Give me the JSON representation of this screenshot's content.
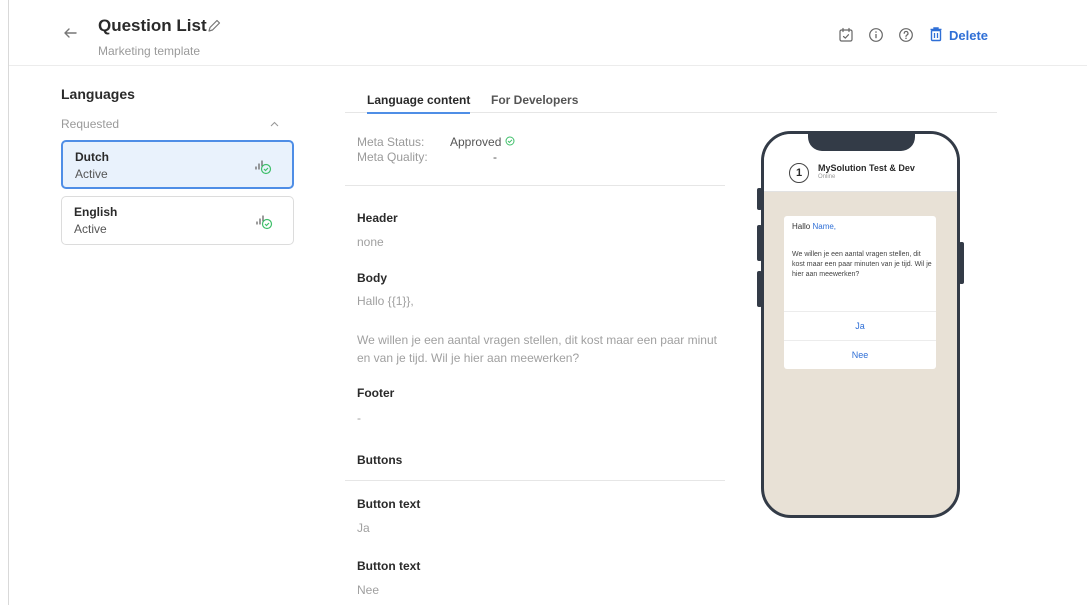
{
  "header": {
    "title": "Question List",
    "subtitle": "Marketing template",
    "delete_label": "Delete",
    "icons": [
      "back-arrow-icon",
      "pencil-icon",
      "calendar-icon",
      "info-icon",
      "help-icon",
      "trash-icon"
    ]
  },
  "languages": {
    "title": "Languages",
    "group_label": "Requested",
    "items": [
      {
        "name": "Dutch",
        "status": "Active",
        "selected": true
      },
      {
        "name": "English",
        "status": "Active",
        "selected": false
      }
    ]
  },
  "tabs": [
    {
      "label": "Language content",
      "active": true
    },
    {
      "label": "For Developers",
      "active": false
    }
  ],
  "meta": {
    "status_label": "Meta Status:",
    "status_value": "Approved",
    "quality_label": "Meta Quality:",
    "quality_value": "-"
  },
  "content": {
    "header_title": "Header",
    "header_value": "none",
    "body_title": "Body",
    "body_line1": "Hallo {{1}},",
    "body_line2": "We willen je een aantal vragen stellen, dit kost maar een paar minut",
    "body_line3": "en van je tijd. Wil je hier aan meewerken?",
    "footer_title": "Footer",
    "footer_value": "-",
    "buttons_title": "Buttons",
    "button1_title": "Button text",
    "button1_value": "Ja",
    "button2_title": "Button text",
    "button2_value": "Nee"
  },
  "preview": {
    "avatar_number": "1",
    "chat_name": "MySolution Test & Dev",
    "chat_status": "Online",
    "greeting": "Hallo",
    "greeting_name": "Name,",
    "message": "We willen je een aantal vragen stellen, dit kost maar een paar minuten van je tijd. Wil je hier aan meewerken?",
    "buttons": [
      "Ja",
      "Nee"
    ]
  },
  "colors": {
    "accent": "#2f6fd6",
    "selected_bg": "#e9f2fc",
    "approved_green": "#3fbf6a",
    "phone_frame": "#333b47"
  }
}
